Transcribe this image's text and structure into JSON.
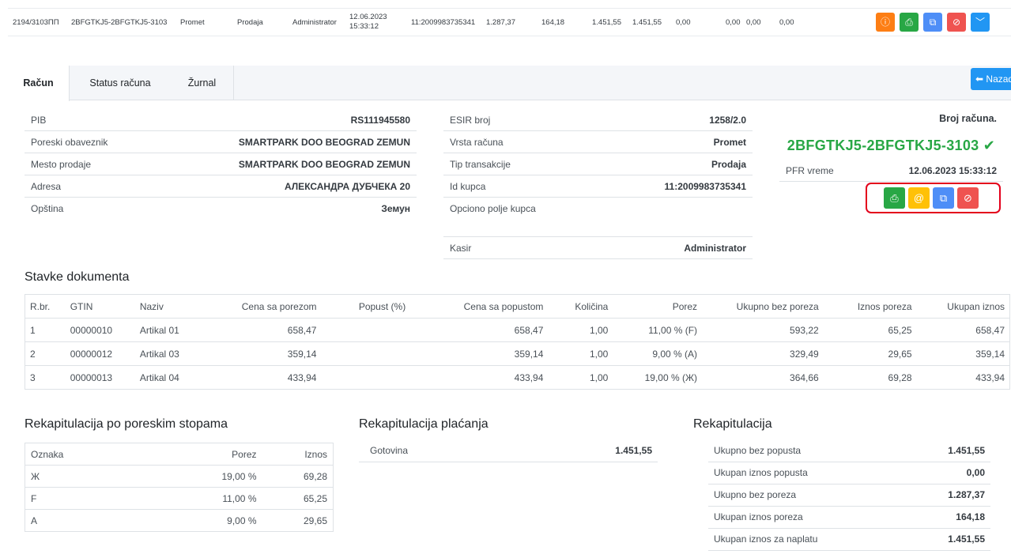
{
  "top_row": {
    "id": "2194/3103ПП",
    "receipt": "2BFGTKJ5-2BFGTKJ5-3103",
    "type": "Promet",
    "transaction": "Prodaja",
    "cashier": "Administrator",
    "date": "12.06.2023",
    "time": "15:33:12",
    "buyer_id": "11:2009983735341",
    "v1": "1.287,37",
    "v2": "164,18",
    "v3": "1.451,55",
    "v4": "1.451,55",
    "v5": "0,00",
    "v6": "0,00",
    "v7": "0,00",
    "v8": "0,00"
  },
  "tabs": [
    "Račun",
    "Status računa",
    "Žurnal"
  ],
  "back_button": "Nazad",
  "company": [
    {
      "k": "PIB",
      "v": "RS111945580"
    },
    {
      "k": "Poreski obaveznik",
      "v": "SMARTPARK DOO BEOGRAD ZEMUN"
    },
    {
      "k": "Mesto prodaje",
      "v": "SMARTPARK DOO BEOGRAD ZEMUN"
    },
    {
      "k": "Adresa",
      "v": "АЛЕКСАНДРА ДУБЧЕКА 20"
    },
    {
      "k": "Opština",
      "v": "Земун"
    }
  ],
  "receipt_info": [
    {
      "k": "ESIR broj",
      "v": "1258/2.0"
    },
    {
      "k": "Vrsta računa",
      "v": "Promet"
    },
    {
      "k": "Tip transakcije",
      "v": "Prodaja"
    },
    {
      "k": "Id kupca",
      "v": "11:2009983735341"
    },
    {
      "k": "Opciono polje kupca",
      "v": ""
    },
    {
      "k": "Kasir",
      "v": "Administrator"
    }
  ],
  "right": {
    "header": "Broj računa.",
    "number": "2BFGTKJ5-2BFGTKJ5-3103",
    "pfr_label": "PFR vreme",
    "pfr_value": "12.06.2023 15:33:12"
  },
  "items_title": "Stavke dokumenta",
  "items_headers": [
    "R.br.",
    "GTIN",
    "Naziv",
    "Cena sa porezom",
    "Popust (%)",
    "Cena sa popustom",
    "Količina",
    "Porez",
    "Ukupno bez poreza",
    "Iznos poreza",
    "Ukupan iznos"
  ],
  "items": [
    [
      "1",
      "00000010",
      "Artikal 01",
      "658,47",
      "",
      "658,47",
      "1,00",
      "11,00 % (F)",
      "593,22",
      "65,25",
      "658,47"
    ],
    [
      "2",
      "00000012",
      "Artikal 03",
      "359,14",
      "",
      "359,14",
      "1,00",
      "9,00 % (A)",
      "329,49",
      "29,65",
      "359,14"
    ],
    [
      "3",
      "00000013",
      "Artikal 04",
      "433,94",
      "",
      "433,94",
      "1,00",
      "19,00 % (Ж)",
      "364,66",
      "69,28",
      "433,94"
    ]
  ],
  "tax_title": "Rekapitulacija po poreskim stopama",
  "tax_headers": [
    "Oznaka",
    "Porez",
    "Iznos"
  ],
  "tax_rows": [
    [
      "Ж",
      "19,00 %",
      "69,28"
    ],
    [
      "F",
      "11,00 %",
      "65,25"
    ],
    [
      "A",
      "9,00 %",
      "29,65"
    ]
  ],
  "pay_title": "Rekapitulacija plaćanja",
  "pay_rows": [
    [
      "Gotovina",
      "1.451,55"
    ]
  ],
  "recap_title": "Rekapitulacija",
  "recap_rows": [
    [
      "Ukupno bez popusta",
      "1.451,55"
    ],
    [
      "Ukupan iznos popusta",
      "0,00"
    ],
    [
      "Ukupno bez poreza",
      "1.287,37"
    ],
    [
      "Ukupan iznos poreza",
      "164,18"
    ],
    [
      "Ukupan iznos za naplatu",
      "1.451,55"
    ]
  ],
  "colors": {
    "orange": "#fd7e14",
    "green": "#28a745",
    "blue": "#4e8ef7",
    "red": "#ef5350",
    "yellow": "#ffc107",
    "sky": "#2196f3"
  }
}
